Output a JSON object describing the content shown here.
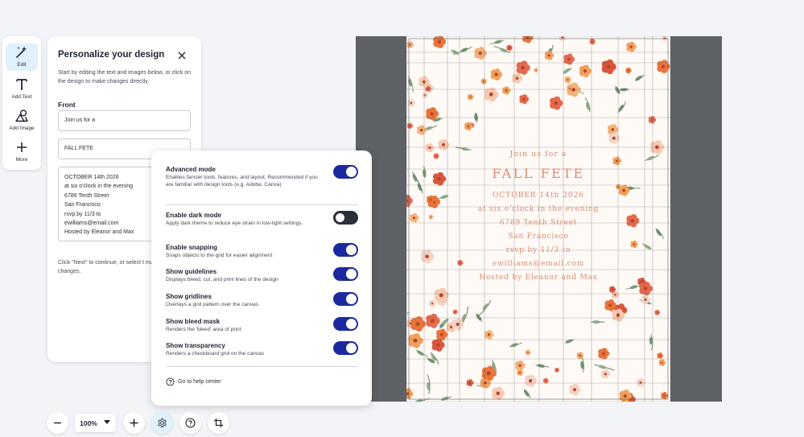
{
  "toolbar": {
    "items": [
      {
        "label": "Edit",
        "icon": "magic-wand-icon",
        "active": true
      },
      {
        "label": "Add Text",
        "icon": "text-icon"
      },
      {
        "label": "Add Image",
        "icon": "image-shapes-icon"
      },
      {
        "label": "More",
        "icon": "plus-icon"
      }
    ]
  },
  "panel": {
    "title": "Personalize your design",
    "intro": "Start by editing the text and images below, or click on the design to make changes directly.",
    "section": "Front",
    "fields": {
      "line1": "Join us for a",
      "line2": "FALL FETE",
      "details": [
        "OCTOBER 14th 2026",
        "at six o'clock in the evening",
        "6789 Tenth Street",
        "San Francisco",
        "rsvp by 11/3 to",
        "ewilliams@email.com",
        "Hosted by Eleanor and Max"
      ]
    },
    "footer": "Click \"Next\" to continue, or select t make additional changes."
  },
  "settings": {
    "items": [
      {
        "label": "Advanced mode",
        "desc": "Enables fancier tools, features, and layout. Recommended if you are familiar with design tools (e.g. Adobe, Canva)",
        "on": true
      },
      {
        "label": "Enable dark mode",
        "desc": "Apply dark theme to reduce eye strain in low-light settings.",
        "on": false
      },
      {
        "label": "Enable snapping",
        "desc": "Snaps objects to the grid for easier alignment",
        "on": true
      },
      {
        "label": "Show guidelines",
        "desc": "Displays bleed, cut, and print lines of the design",
        "on": true
      },
      {
        "label": "Show gridlines",
        "desc": "Overlays a grid pattern over the canvas",
        "on": true
      },
      {
        "label": "Show bleed mask",
        "desc": "Renders the 'bleed' area of print",
        "on": true
      },
      {
        "label": "Show transparency",
        "desc": "Renders a checkboard grid on the canvas",
        "on": true
      }
    ],
    "help": "Go to help center"
  },
  "bottombar": {
    "zoom": "100%",
    "buttons": [
      "minus-icon",
      "plus-icon",
      "gear-icon",
      "help-icon",
      "crop-icon"
    ]
  },
  "card": {
    "lines": [
      "Join us for a",
      "FALL FETE",
      "OCTOBER 14th 2026",
      "at six o'clock in the evening",
      "6789 Tenth Street",
      "San Francisco",
      "rsvp by 11/3 to",
      "ewilliams@email.com",
      "Hosted by Eleanor and Max"
    ]
  },
  "colors": {
    "accent": "#1c2aa0",
    "active_bg": "#dff1fc",
    "canvas_bg": "#5e6166",
    "card_text": "#d98b72"
  }
}
